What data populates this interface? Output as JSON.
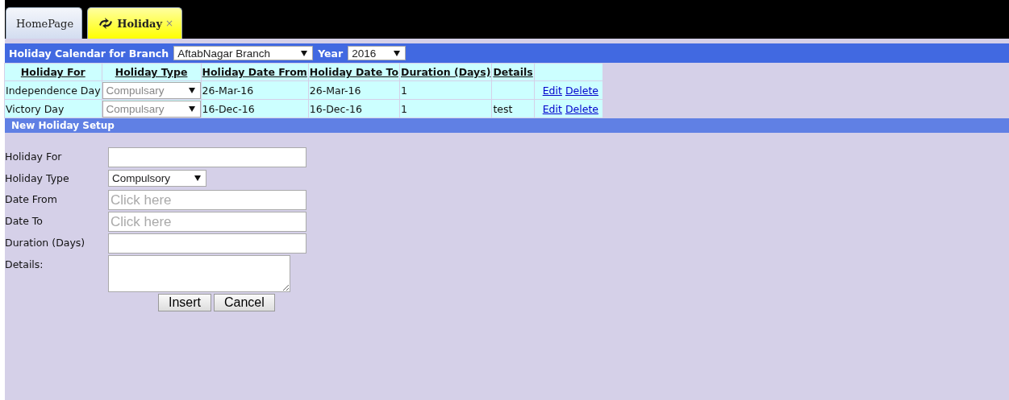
{
  "tabs": [
    {
      "label": "HomePage",
      "selected": false
    },
    {
      "label": "Holiday",
      "selected": true,
      "close": "×"
    }
  ],
  "calendar_header": {
    "title": "Holiday Calendar for Branch",
    "branch": {
      "value": "AftabNagar Branch"
    },
    "year_label": "Year",
    "year": {
      "value": "2016"
    }
  },
  "table": {
    "columns": [
      "Holiday For",
      "Holiday Type",
      "Holiday Date From",
      "Holiday Date To",
      "Duration (Days)",
      "Details"
    ],
    "rows": [
      {
        "holiday_for": "Independence Day",
        "holiday_type": {
          "value": "Compulsary",
          "disabled": true
        },
        "date_from": "26-Mar-16",
        "date_to": "26-Mar-16",
        "duration": "1",
        "details": "",
        "actions": [
          "Edit",
          "Delete"
        ]
      },
      {
        "holiday_for": "Victory Day",
        "holiday_type": {
          "value": "Compulsary",
          "disabled": true
        },
        "date_from": "16-Dec-16",
        "date_to": "16-Dec-16",
        "duration": "1",
        "details": "test",
        "actions": [
          "Edit",
          "Delete"
        ]
      }
    ]
  },
  "form": {
    "title": "New Holiday Setup",
    "fields": [
      {
        "label": "Holiday For",
        "kind": "text"
      },
      {
        "label": "Holiday Type",
        "kind": "select",
        "value": "Compulsory"
      },
      {
        "label": "Date From",
        "kind": "text",
        "placeholder": "Click here"
      },
      {
        "label": "Date To",
        "kind": "text",
        "placeholder": "Click here"
      },
      {
        "label": "Duration (Days)",
        "kind": "text"
      },
      {
        "label": "Details:",
        "kind": "textarea"
      }
    ],
    "buttons": [
      "Insert",
      "Cancel"
    ]
  }
}
